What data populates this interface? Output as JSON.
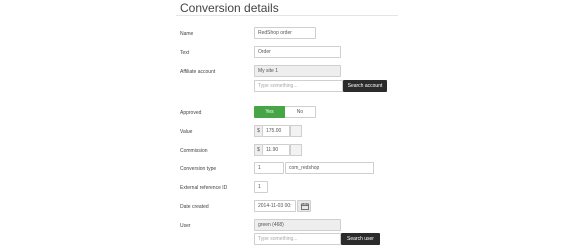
{
  "page": {
    "title": "Conversion details"
  },
  "form": {
    "name": {
      "label": "Name",
      "value": "RedShop order"
    },
    "text": {
      "label": "Text",
      "value": "Order"
    },
    "affiliate_account": {
      "label": "Affiliate account",
      "value": "My site 1",
      "search_placeholder": "Type something...",
      "search_button": "Search account"
    },
    "approved": {
      "label": "Approved",
      "yes": "Yes",
      "no": "No",
      "selected": "Yes"
    },
    "value": {
      "label": "Value",
      "currency": "$",
      "amount": "175.00"
    },
    "commission": {
      "label": "Commission",
      "currency": "$",
      "amount": "11.90"
    },
    "conversion_type": {
      "label": "Conversion type",
      "id": "1",
      "name": "com_redshop"
    },
    "external_reference": {
      "label": "External reference ID",
      "value": "1"
    },
    "date_created": {
      "label": "Date created",
      "value": "2014-11-03 00:"
    },
    "user": {
      "label": "User",
      "value": "green (468)",
      "search_placeholder": "Type something...",
      "search_button": "Search user"
    }
  },
  "colors": {
    "accent_green": "#46a546",
    "dark_button": "#2b2b2b",
    "readonly_bg": "#eeeeee"
  },
  "icons": {
    "date_picker": "calendar-icon"
  }
}
